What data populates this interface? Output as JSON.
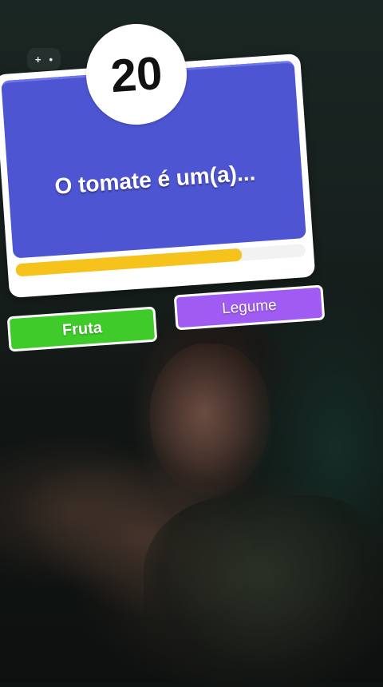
{
  "timer": {
    "value": "20"
  },
  "question": {
    "text": "O tomate é um(a)..."
  },
  "progress": {
    "fraction": 0.78
  },
  "answers": [
    {
      "label": "Fruta",
      "color": "#3fcb2a"
    },
    {
      "label": "Legume",
      "color": "#a05cf2"
    }
  ],
  "icons": {
    "top_left": "gamepad-icon"
  },
  "colors": {
    "card_blue": "#4e55d2",
    "progress": "#f6c21c"
  }
}
